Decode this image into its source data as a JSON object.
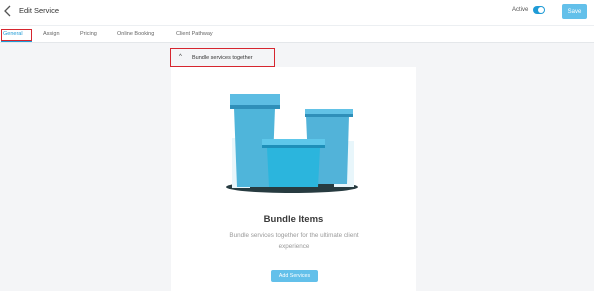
{
  "header": {
    "title": "Edit Service",
    "active_label": "Active",
    "active_state": true,
    "save_label": "Save",
    "accent_color": "#1f9bd6",
    "button_color": "#63c0ea"
  },
  "tabs": [
    {
      "label": "General",
      "active": true
    },
    {
      "label": "Assign",
      "active": false
    },
    {
      "label": "Pricing",
      "active": false
    },
    {
      "label": "Online Booking",
      "active": false
    },
    {
      "label": "Client Pathway",
      "active": false
    }
  ],
  "bundle_section": {
    "toggle_label": "Bundle services together",
    "toggle_icon": "chevron-up-icon",
    "heading": "Bundle Items",
    "description": "Bundle services together for the ultimate client experience",
    "add_button_label": "Add Services",
    "illustration": "gift-boxes-illustration"
  },
  "annotations": {
    "highlight_color": "#d6262f"
  }
}
